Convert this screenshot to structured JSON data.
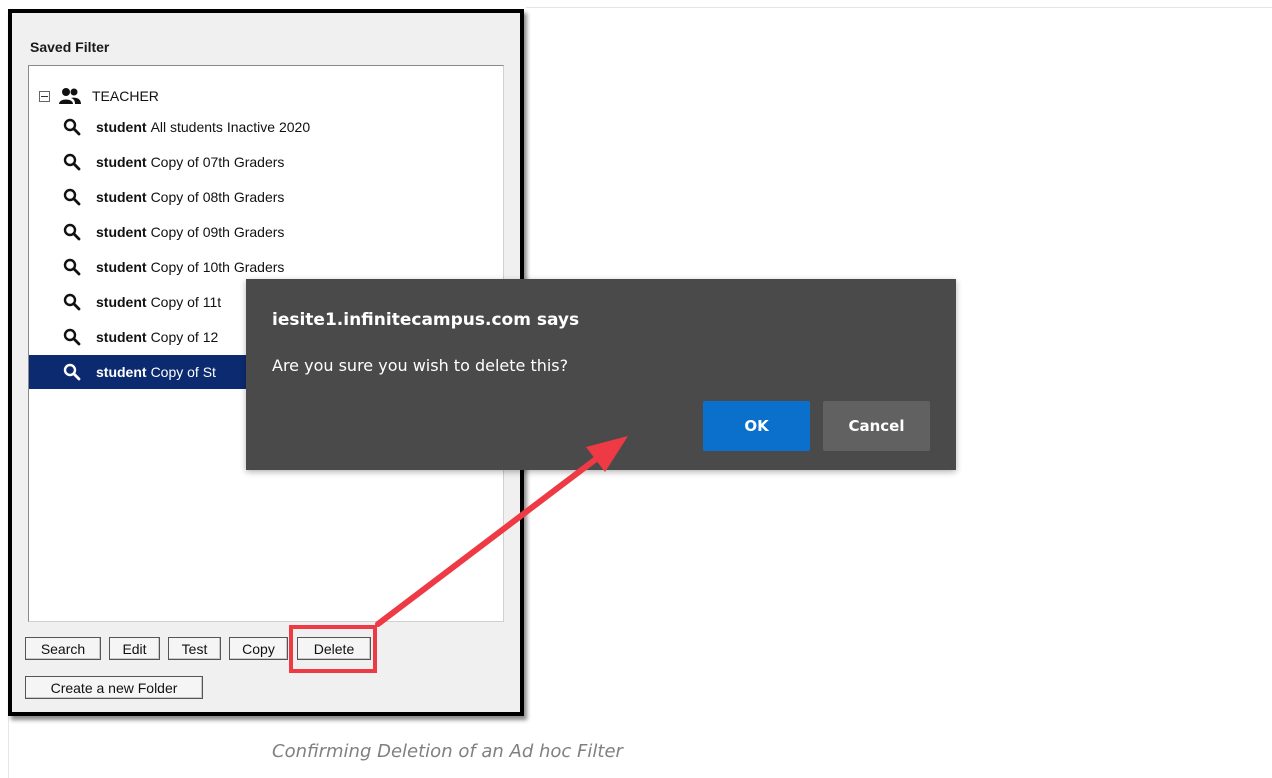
{
  "panel": {
    "title": "Saved Filter",
    "root": {
      "label": "TEACHER",
      "icon": "users-icon"
    },
    "items": [
      {
        "type": "student",
        "name": "All students Inactive 2020",
        "selected": false
      },
      {
        "type": "student",
        "name": "Copy of 07th Graders",
        "selected": false
      },
      {
        "type": "student",
        "name": "Copy of 08th Graders",
        "selected": false
      },
      {
        "type": "student",
        "name": "Copy of 09th Graders",
        "selected": false
      },
      {
        "type": "student",
        "name": "Copy of 10th Graders",
        "selected": false
      },
      {
        "type": "student",
        "name": "Copy of 11t",
        "selected": false
      },
      {
        "type": "student",
        "name": "Copy of 12",
        "selected": false
      },
      {
        "type": "student",
        "name": "Copy of St",
        "selected": true
      }
    ],
    "buttons": {
      "search": "Search",
      "edit": "Edit",
      "test": "Test",
      "copy": "Copy",
      "delete": "Delete",
      "new_folder": "Create a new Folder"
    }
  },
  "dialog": {
    "title": "iesite1.infinitecampus.com says",
    "message": "Are you sure you wish to delete this?",
    "ok": "OK",
    "cancel": "Cancel"
  },
  "caption": "Confirming Deletion of an Ad hoc Filter",
  "colors": {
    "selection": "#0b2a6f",
    "dialog_bg": "#4a4a4a",
    "ok_button": "#0b6fcc",
    "annotation": "#ee3a45"
  }
}
